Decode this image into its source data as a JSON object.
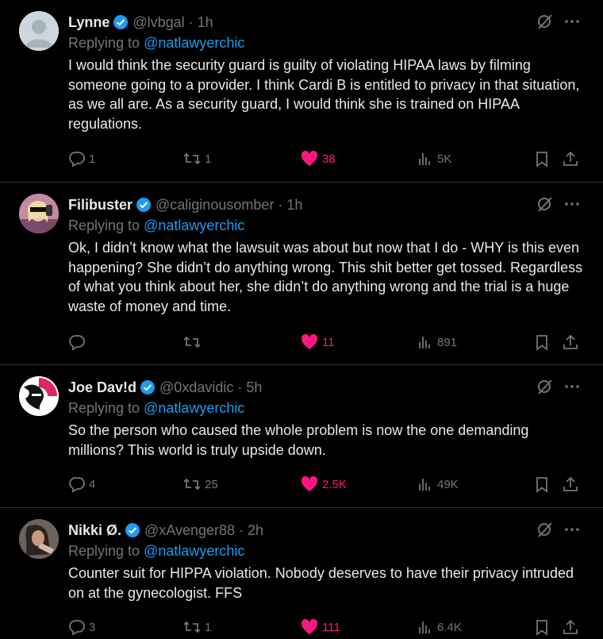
{
  "colors": {
    "background": "#000000",
    "text": "#e7e9ea",
    "muted": "#71767b",
    "link": "#1d9bf0",
    "like": "#f91880",
    "verified": "#1d9bf0"
  },
  "tweets": [
    {
      "name": "Lynne",
      "handle": "@lvbgal",
      "time": "1h",
      "replying_label": "Replying to",
      "replying_to": "@natlawyerchic",
      "text": "I would think the security guard is guilty of violating HIPAA laws by filming someone going to a provider. I think Cardi B is entitled to privacy in that situation, as we all are.  As a security guard, I would think she is trained on HIPAA regulations.",
      "replies": "1",
      "retweets": "1",
      "likes": "38",
      "views": "5K",
      "liked": true
    },
    {
      "name": "Filibuster",
      "handle": "@caliginousomber",
      "time": "1h",
      "replying_label": "Replying to",
      "replying_to": "@natlawyerchic",
      "text": "Ok, I didn’t know what the lawsuit was about but now that I do - WHY is this even happening? She didn’t do anything wrong. This shit better get tossed. Regardless of what you think about her, she didn’t do anything wrong and the trial is a huge waste of money and time.",
      "replies": "",
      "retweets": "",
      "likes": "11",
      "views": "891",
      "liked": true
    },
    {
      "name": "Joe Dav!d",
      "handle": "@0xdavidic",
      "time": "5h",
      "replying_label": "Replying to",
      "replying_to": "@natlawyerchic",
      "text": "So the person who caused the whole problem is now the one demanding millions? This world is truly upside down.",
      "replies": "4",
      "retweets": "25",
      "likes": "2.5K",
      "views": "49K",
      "liked": true
    },
    {
      "name": "Nikki Ø.",
      "handle": "@xAvenger88",
      "time": "2h",
      "replying_label": "Replying to",
      "replying_to": "@natlawyerchic",
      "text": "Counter suit for HIPPA violation. Nobody deserves to have their privacy intruded on at the gynecologist. FFS",
      "replies": "3",
      "retweets": "1",
      "likes": "111",
      "views": "6.4K",
      "liked": true
    }
  ]
}
